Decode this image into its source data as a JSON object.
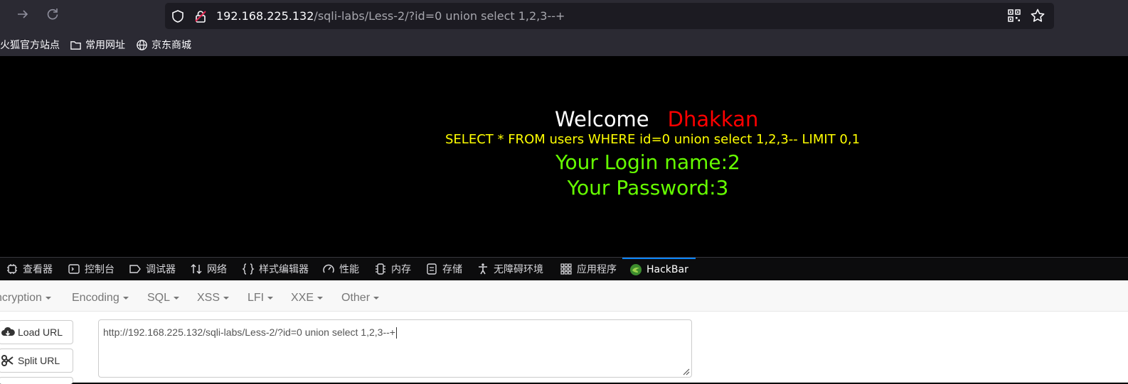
{
  "browser": {
    "url_host": "192.168.225.132",
    "url_path": "/sqli-labs/Less-2/?id=0 union select 1,2,3--+",
    "bookmarks": [
      "火狐官方站点",
      "常用网址",
      "京东商城"
    ]
  },
  "page": {
    "welcome": "Welcome",
    "user": "Dhakkan",
    "query": "SELECT * FROM users WHERE id=0 union select 1,2,3-- LIMIT 0,1",
    "login_name": "Your Login name:2",
    "password": "Your Password:3"
  },
  "devtools": {
    "tabs": [
      {
        "label": "查看器",
        "icon": "inspector-icon"
      },
      {
        "label": "控制台",
        "icon": "console-icon"
      },
      {
        "label": "调试器",
        "icon": "debugger-icon"
      },
      {
        "label": "网络",
        "icon": "network-icon"
      },
      {
        "label": "样式编辑器",
        "icon": "style-editor-icon"
      },
      {
        "label": "性能",
        "icon": "performance-icon"
      },
      {
        "label": "内存",
        "icon": "memory-icon"
      },
      {
        "label": "存储",
        "icon": "storage-icon"
      },
      {
        "label": "无障碍环境",
        "icon": "accessibility-icon"
      },
      {
        "label": "应用程序",
        "icon": "application-icon"
      },
      {
        "label": "HackBar",
        "icon": "hackbar-icon",
        "active": true
      }
    ]
  },
  "hackbar": {
    "menu": [
      "ncryption",
      "Encoding",
      "SQL",
      "XSS",
      "LFI",
      "XXE",
      "Other"
    ],
    "load_url_label": "Load URL",
    "split_url_label": "Split URL",
    "url_value": "http://192.168.225.132/sqli-labs/Less-2/?id=0 union select 1,2,3--+"
  },
  "colors": {
    "welcome": "#ffffff",
    "user": "#ff0000",
    "query": "#ffff00",
    "result": "#66ff00",
    "tab_active": "#0a84ff"
  }
}
